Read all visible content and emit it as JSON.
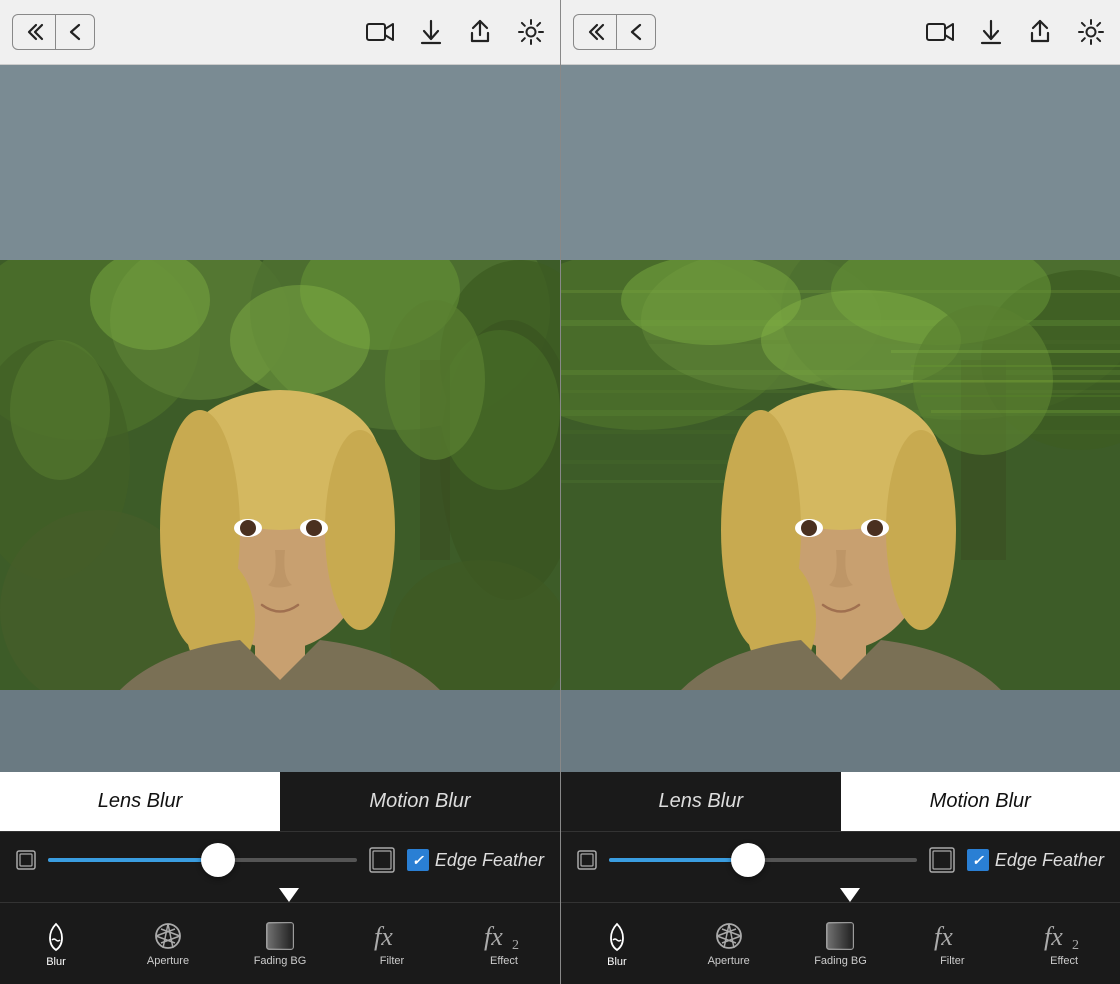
{
  "panels": [
    {
      "id": "left",
      "toolbar": {
        "back_double": "«",
        "back_single": "<",
        "video_icon": "video",
        "download_icon": "download",
        "share_icon": "share",
        "settings_icon": "settings"
      },
      "blur_tabs": [
        {
          "id": "lens",
          "label": "Lens Blur",
          "active": true
        },
        {
          "id": "motion",
          "label": "Motion Blur",
          "active": false
        }
      ],
      "slider": {
        "value": 55
      },
      "edge_feather": {
        "label": "Edge Feather",
        "checked": true
      },
      "bottom_tools": [
        {
          "id": "blur",
          "label": "Blur",
          "selected": true
        },
        {
          "id": "aperture",
          "label": "Aperture",
          "selected": false
        },
        {
          "id": "fading_bg",
          "label": "Fading BG",
          "selected": false
        },
        {
          "id": "filter",
          "label": "Filter",
          "selected": false
        },
        {
          "id": "effect",
          "label": "Effect",
          "selected": false
        }
      ]
    },
    {
      "id": "right",
      "toolbar": {
        "back_double": "«",
        "back_single": "<",
        "video_icon": "video",
        "download_icon": "download",
        "share_icon": "share",
        "settings_icon": "settings"
      },
      "blur_tabs": [
        {
          "id": "lens",
          "label": "Lens Blur",
          "active": false
        },
        {
          "id": "motion",
          "label": "Motion Blur",
          "active": true
        }
      ],
      "slider": {
        "value": 45
      },
      "edge_feather": {
        "label": "Edge Feather",
        "checked": true
      },
      "bottom_tools": [
        {
          "id": "blur",
          "label": "Blur",
          "selected": true
        },
        {
          "id": "aperture",
          "label": "Aperture",
          "selected": false
        },
        {
          "id": "fading_bg",
          "label": "Fading BG",
          "selected": false
        },
        {
          "id": "filter",
          "label": "Filter",
          "selected": false
        },
        {
          "id": "effect",
          "label": "Effect",
          "selected": false
        }
      ]
    }
  ]
}
